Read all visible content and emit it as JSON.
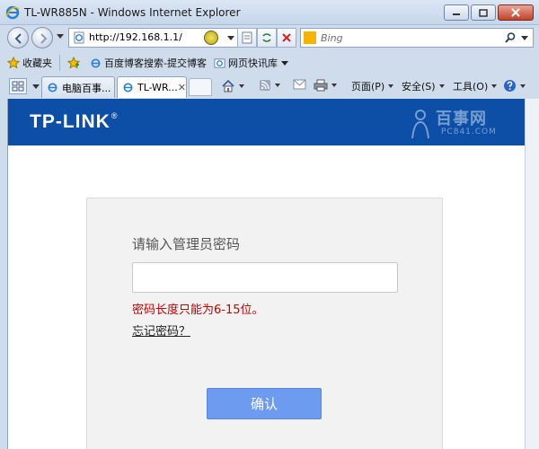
{
  "window": {
    "title": "TL-WR885N - Windows Internet Explorer"
  },
  "address_bar": {
    "url": "http://192.168.1.1/"
  },
  "search": {
    "placeholder": "Bing"
  },
  "favorites_bar": {
    "favorites_label": "收藏夹",
    "items": [
      "百度博客搜索-提交博客",
      "网页快讯库"
    ]
  },
  "tabs": [
    {
      "label": "电脑百事..."
    },
    {
      "label": "TL-WR..."
    }
  ],
  "tab_close_glyph": "✕",
  "command_bar": {
    "page": "页面(P)",
    "safety": "安全(S)",
    "tools": "工具(O)"
  },
  "banner": {
    "logo_text": "TP-LINK",
    "logo_mark": "®",
    "watermark_text": "百事网",
    "watermark_sub": "PC841.COM",
    "color": "#0d4ea6"
  },
  "login": {
    "prompt": "请输入管理员密码",
    "password_value": "",
    "error": "密码长度只能为6-15位。",
    "forgot": "忘记密码？",
    "confirm": "确认",
    "confirm_color": "#6d9bf0",
    "error_color": "#c00000"
  }
}
